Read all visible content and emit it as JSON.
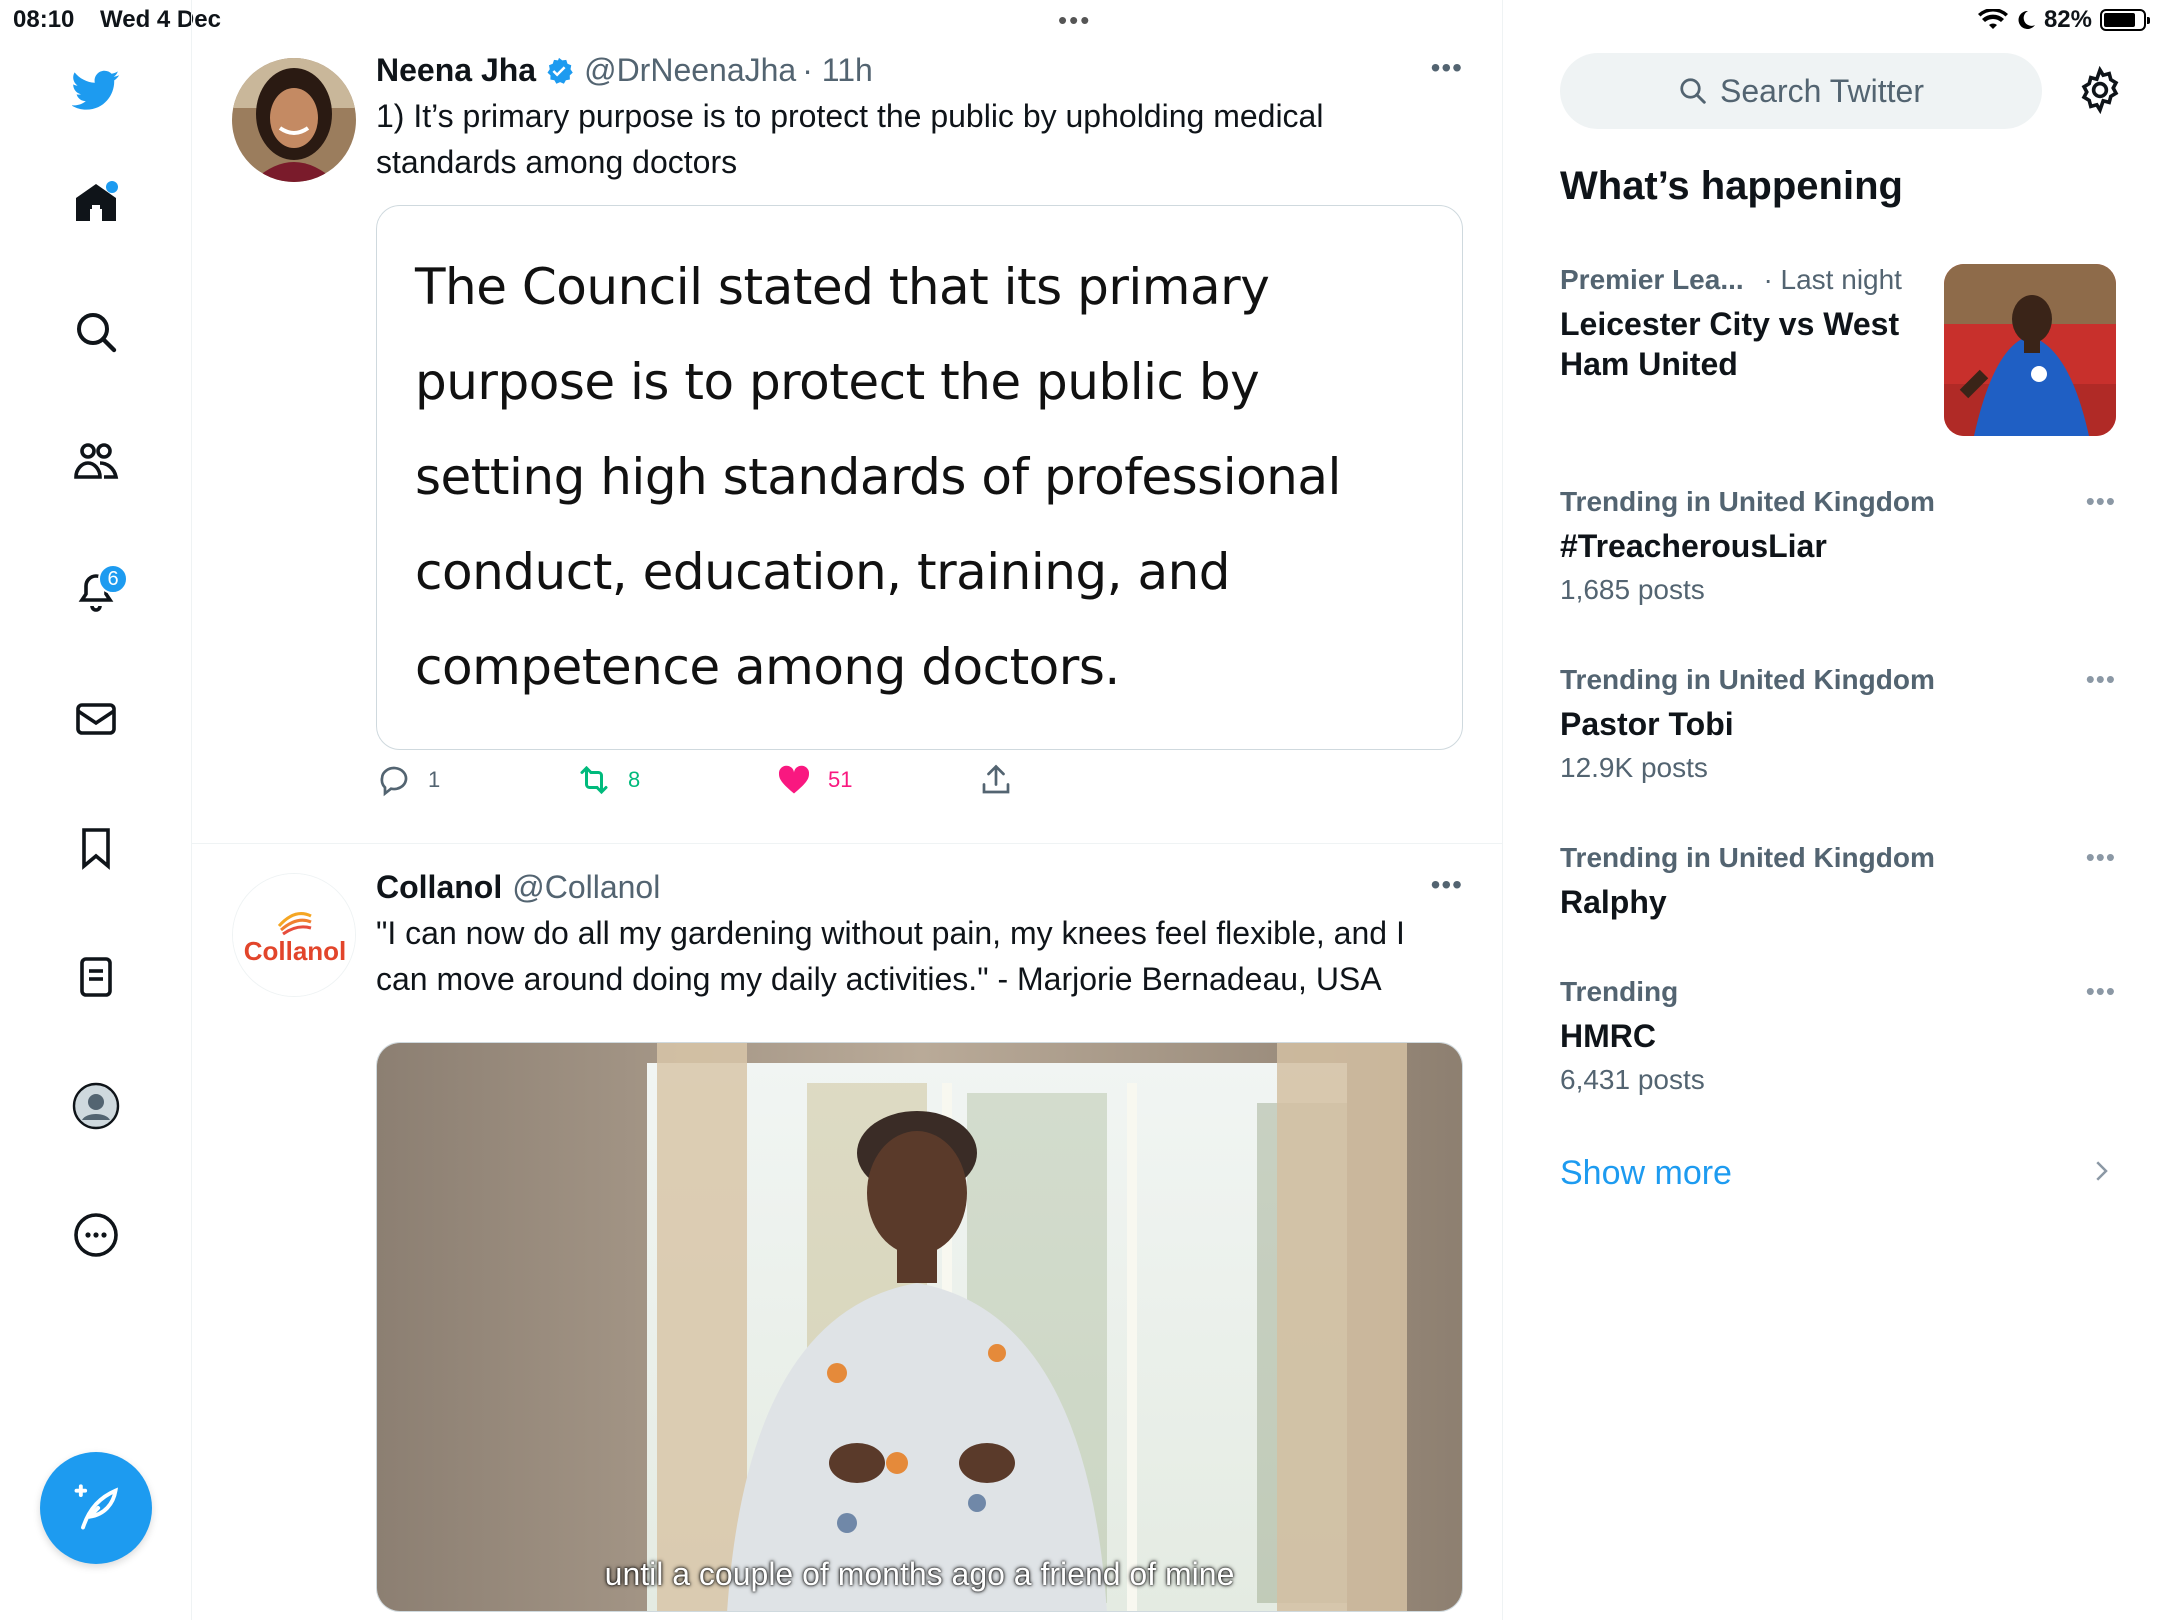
{
  "status_bar": {
    "time": "08:10",
    "date": "Wed 4 Dec",
    "battery": "82%",
    "battery_level": 0.82
  },
  "nav": {
    "notifications_badge": "6",
    "items": [
      "home",
      "explore",
      "communities",
      "notifications",
      "messages",
      "bookmarks",
      "lists",
      "profile",
      "more"
    ]
  },
  "tweets": [
    {
      "name": "Neena Jha",
      "handle": "@DrNeenaJha",
      "time": "· 11h",
      "text": "1) It’s primary purpose is to protect the public by upholding medical standards among doctors",
      "quote_image_text": "The Council stated that its primary purpose is to protect the public by setting high standards of professional conduct, education, training, and competence among doctors.",
      "replies": "1",
      "retweets": "8",
      "likes": "51"
    },
    {
      "name": "Collanol",
      "handle": "@Collanol",
      "logo_text": "Collanol",
      "text": "\"I can now do all my gardening without pain, my knees feel flexible, and I can move around doing my daily activities.\" - Marjorie Bernadeau, USA",
      "video_caption": "until a couple of months ago a friend of mine"
    }
  ],
  "right": {
    "search_placeholder": "Search Twitter",
    "section_title": "What’s happening",
    "trends": [
      {
        "meta": "Premier Lea...",
        "meta_time": "· Last night",
        "name": "Leicester City vs West Ham United",
        "count": ""
      },
      {
        "meta": "Trending in United Kingdom",
        "name": "#TreacherousLiar",
        "count": "1,685 posts"
      },
      {
        "meta": "Trending in United Kingdom",
        "name": "Pastor Tobi",
        "count": "12.9K posts"
      },
      {
        "meta": "Trending in United Kingdom",
        "name": "Ralphy",
        "count": ""
      },
      {
        "meta": "Trending",
        "name": "HMRC",
        "count": "6,431 posts"
      }
    ],
    "show_more": "Show more"
  },
  "colors": {
    "accent": "#1d9bf0",
    "like": "#f91880",
    "retweet": "#00ba7c",
    "muted": "#536471"
  }
}
